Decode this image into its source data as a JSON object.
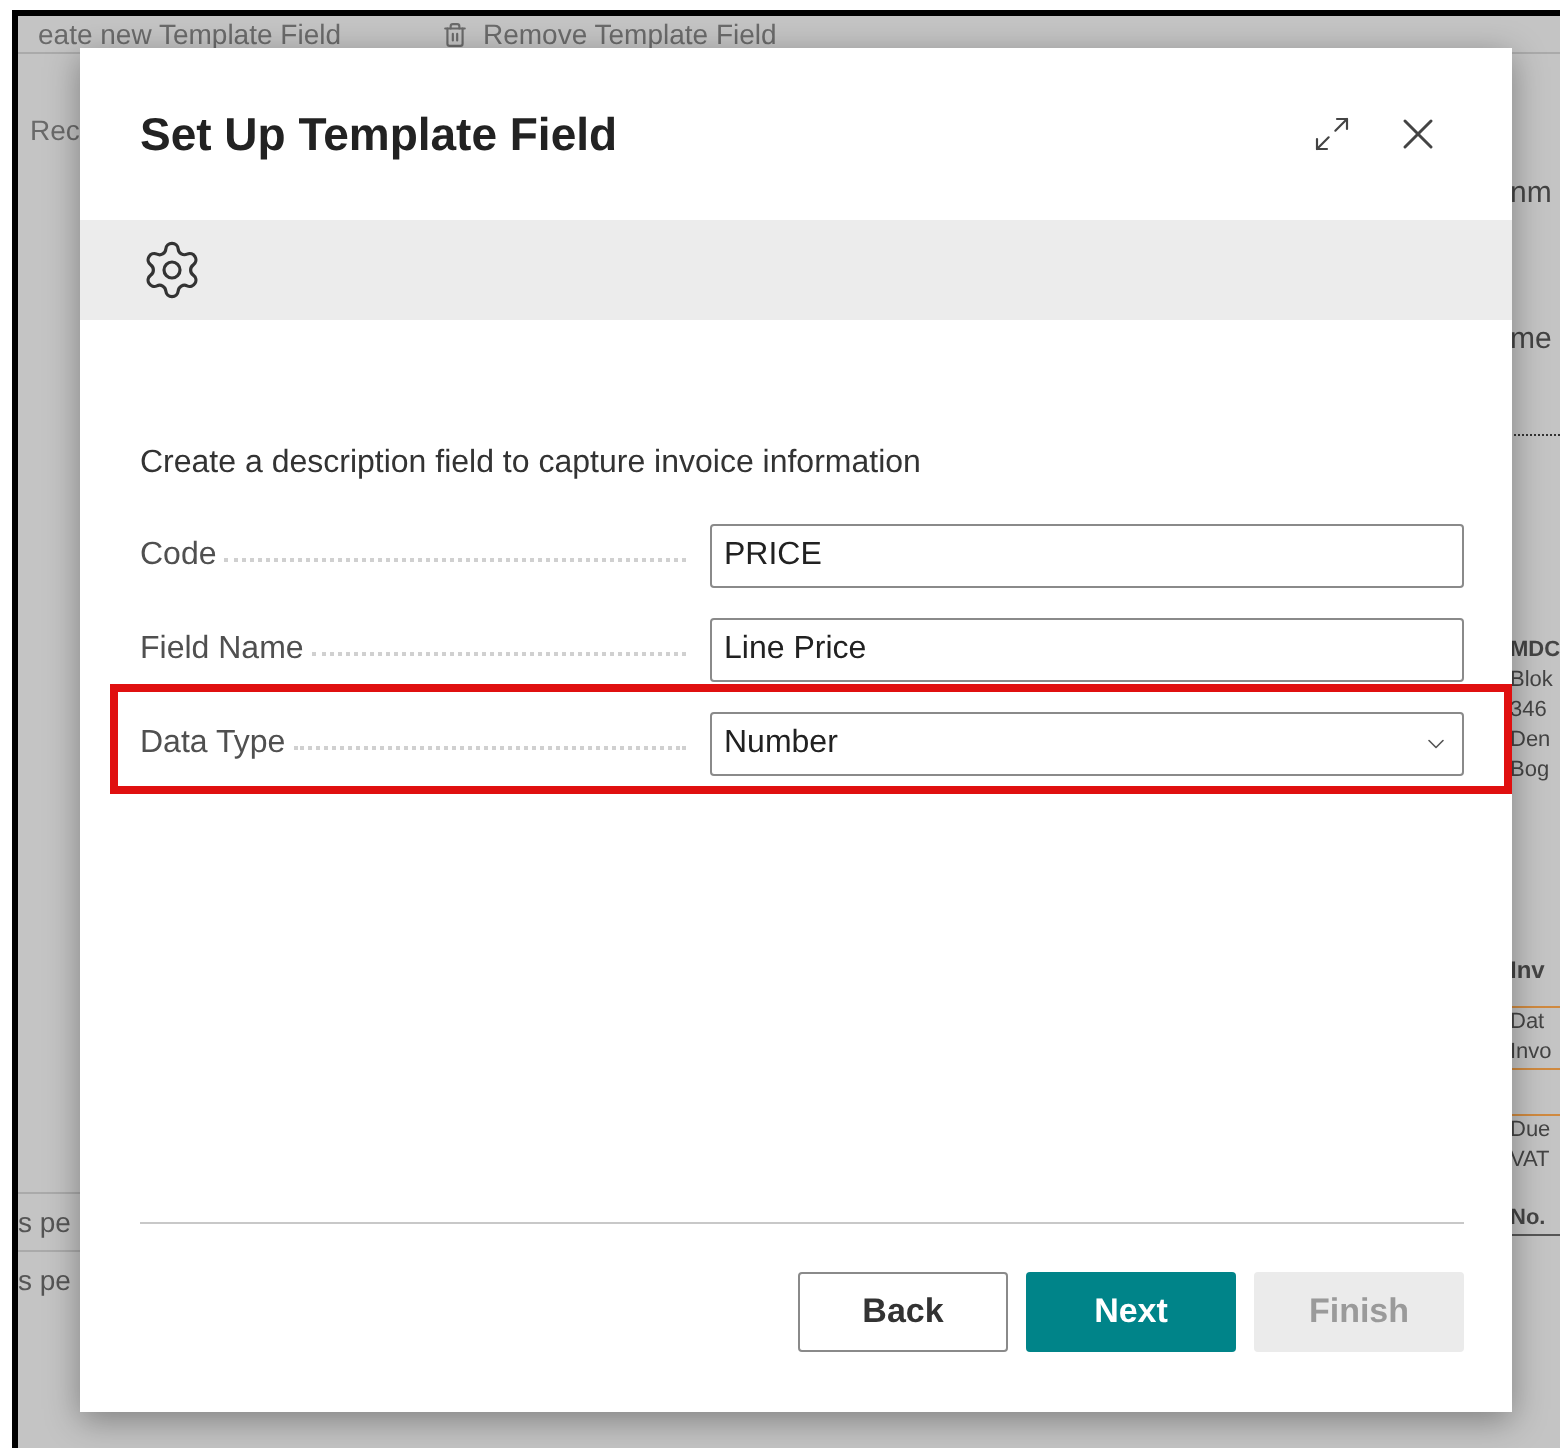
{
  "background": {
    "toolbar": [
      {
        "label": "eate new Template Field",
        "icon": false
      },
      {
        "label": "Remove Template Field",
        "icon": true
      }
    ],
    "left_column": {
      "heading": "Rec",
      "rows": [
        "s pe",
        "s pe"
      ]
    },
    "right_column": [
      "nm",
      "me",
      "MDC",
      "Blok",
      "346",
      "Den",
      "Bog",
      "Inv",
      "Dat",
      "Invo",
      "Due",
      "VAT",
      "No."
    ]
  },
  "dialog": {
    "title": "Set Up Template Field",
    "description": "Create a description field to capture invoice information",
    "fields": [
      {
        "kind": "text",
        "label": "Code",
        "value": "PRICE",
        "highlighted": false
      },
      {
        "kind": "text",
        "label": "Field Name",
        "value": "Line Price",
        "highlighted": false
      },
      {
        "kind": "select",
        "label": "Data Type",
        "value": "Number",
        "highlighted": true
      }
    ],
    "buttons": [
      {
        "label": "Back",
        "kind": "secondary",
        "disabled": false
      },
      {
        "label": "Next",
        "kind": "primary",
        "disabled": false
      },
      {
        "label": "Finish",
        "kind": "primary",
        "disabled": true
      }
    ]
  }
}
